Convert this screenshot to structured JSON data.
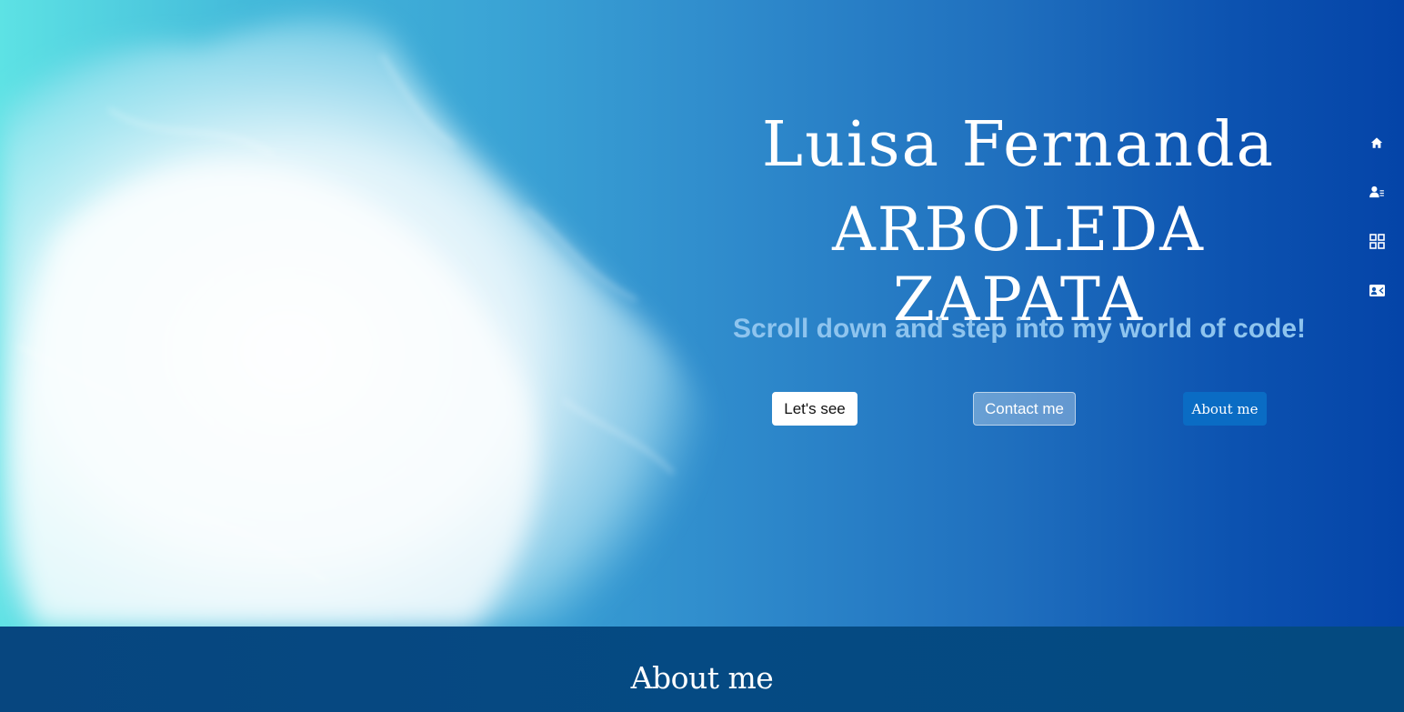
{
  "hero": {
    "name_line1": "Luisa Fernanda",
    "name_line2": "ARBOLEDA ZAPATA",
    "tagline": "Scroll down and step into my world of code!",
    "buttons": {
      "lets_see": "Let's see",
      "contact": "Contact me",
      "about": "About me"
    }
  },
  "nav": {
    "icons": [
      "home-icon",
      "profile-list-icon",
      "grid-icon",
      "contact-card-icon"
    ]
  },
  "about": {
    "title": "About me"
  },
  "colors": {
    "gradient_start": "#5de2e4",
    "gradient_end": "#0444a8",
    "about_bg": "#05497f",
    "tagline": "#8ec4ee",
    "about_button": "#0a6cc4"
  }
}
